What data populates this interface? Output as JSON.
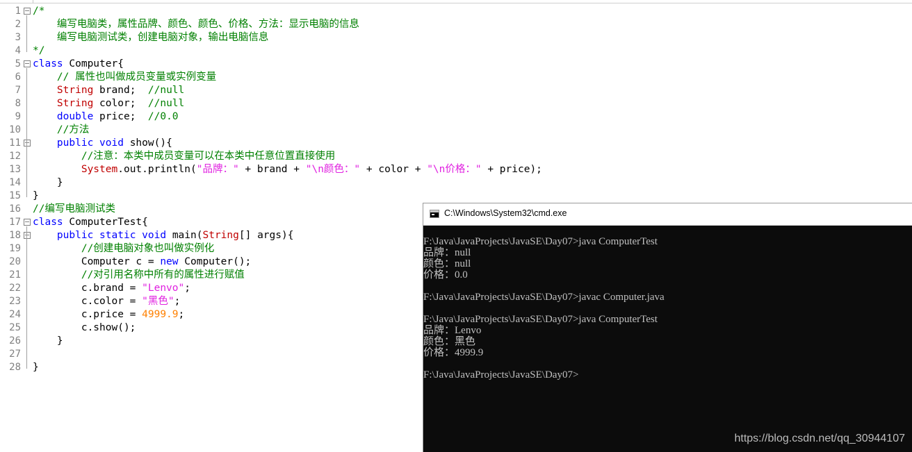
{
  "editor": {
    "lines": [
      {
        "n": "1",
        "fold": true,
        "segs": [
          {
            "t": "/*",
            "c": "cm"
          }
        ]
      },
      {
        "n": "2",
        "segs": [
          {
            "t": "    编写电脑类，属性品牌、颜色、颜色、价格、方法：显示电脑的信息",
            "c": "cm"
          }
        ]
      },
      {
        "n": "3",
        "segs": [
          {
            "t": "    编写电脑测试类，创建电脑对象，输出电脑信息",
            "c": "cm"
          }
        ]
      },
      {
        "n": "4",
        "segs": [
          {
            "t": "*/",
            "c": "cm"
          }
        ]
      },
      {
        "n": "5",
        "fold": true,
        "segs": [
          {
            "t": "class",
            "c": "kw"
          },
          {
            "t": " Computer{",
            "c": ""
          }
        ]
      },
      {
        "n": "6",
        "segs": [
          {
            "t": "    ",
            "c": ""
          },
          {
            "t": "// 属性也叫做成员变量或实例变量",
            "c": "cm"
          }
        ]
      },
      {
        "n": "7",
        "segs": [
          {
            "t": "    ",
            "c": ""
          },
          {
            "t": "String",
            "c": "ty2"
          },
          {
            "t": " brand;  ",
            "c": ""
          },
          {
            "t": "//null",
            "c": "cm"
          }
        ]
      },
      {
        "n": "8",
        "segs": [
          {
            "t": "    ",
            "c": ""
          },
          {
            "t": "String",
            "c": "ty2"
          },
          {
            "t": " color;  ",
            "c": ""
          },
          {
            "t": "//null",
            "c": "cm"
          }
        ]
      },
      {
        "n": "9",
        "segs": [
          {
            "t": "    ",
            "c": ""
          },
          {
            "t": "double",
            "c": "kw"
          },
          {
            "t": " price;  ",
            "c": ""
          },
          {
            "t": "//0.0",
            "c": "cm"
          }
        ]
      },
      {
        "n": "10",
        "segs": [
          {
            "t": "    ",
            "c": ""
          },
          {
            "t": "//方法",
            "c": "cm"
          }
        ]
      },
      {
        "n": "11",
        "fold": true,
        "segs": [
          {
            "t": "    ",
            "c": ""
          },
          {
            "t": "public",
            "c": "kw"
          },
          {
            "t": " ",
            "c": ""
          },
          {
            "t": "void",
            "c": "kw"
          },
          {
            "t": " show(){",
            "c": ""
          }
        ]
      },
      {
        "n": "12",
        "segs": [
          {
            "t": "        ",
            "c": ""
          },
          {
            "t": "//注意：本类中成员变量可以在本类中任意位置直接使用",
            "c": "cm"
          }
        ]
      },
      {
        "n": "13",
        "segs": [
          {
            "t": "        ",
            "c": ""
          },
          {
            "t": "System",
            "c": "ty2"
          },
          {
            "t": ".out.println(",
            "c": ""
          },
          {
            "t": "\"品牌：\"",
            "c": "str"
          },
          {
            "t": " + brand + ",
            "c": ""
          },
          {
            "t": "\"\\n颜色：\"",
            "c": "str"
          },
          {
            "t": " + color + ",
            "c": ""
          },
          {
            "t": "\"\\n价格：\"",
            "c": "str"
          },
          {
            "t": " + price);",
            "c": ""
          }
        ]
      },
      {
        "n": "14",
        "segs": [
          {
            "t": "    }",
            "c": ""
          }
        ]
      },
      {
        "n": "15",
        "segs": [
          {
            "t": "}",
            "c": ""
          }
        ]
      },
      {
        "n": "16",
        "segs": [
          {
            "t": "//编写电脑测试类",
            "c": "cm"
          }
        ]
      },
      {
        "n": "17",
        "fold": true,
        "segs": [
          {
            "t": "class",
            "c": "kw"
          },
          {
            "t": " ComputerTest{",
            "c": ""
          }
        ]
      },
      {
        "n": "18",
        "fold": true,
        "segs": [
          {
            "t": "    ",
            "c": ""
          },
          {
            "t": "public",
            "c": "kw"
          },
          {
            "t": " ",
            "c": ""
          },
          {
            "t": "static",
            "c": "kw"
          },
          {
            "t": " ",
            "c": ""
          },
          {
            "t": "void",
            "c": "kw"
          },
          {
            "t": " main(",
            "c": ""
          },
          {
            "t": "String",
            "c": "ty2"
          },
          {
            "t": "[] args){",
            "c": ""
          }
        ]
      },
      {
        "n": "19",
        "segs": [
          {
            "t": "        ",
            "c": ""
          },
          {
            "t": "//创建电脑对象也叫做实例化",
            "c": "cm"
          }
        ]
      },
      {
        "n": "20",
        "segs": [
          {
            "t": "        Computer c = ",
            "c": ""
          },
          {
            "t": "new",
            "c": "kw"
          },
          {
            "t": " Computer();",
            "c": ""
          }
        ]
      },
      {
        "n": "21",
        "segs": [
          {
            "t": "        ",
            "c": ""
          },
          {
            "t": "//对引用名称中所有的属性进行赋值",
            "c": "cm"
          }
        ]
      },
      {
        "n": "22",
        "segs": [
          {
            "t": "        c.brand = ",
            "c": ""
          },
          {
            "t": "\"Lenvo\"",
            "c": "str"
          },
          {
            "t": ";",
            "c": ""
          }
        ]
      },
      {
        "n": "23",
        "segs": [
          {
            "t": "        c.color = ",
            "c": ""
          },
          {
            "t": "\"黑色\"",
            "c": "str"
          },
          {
            "t": ";",
            "c": ""
          }
        ]
      },
      {
        "n": "24",
        "segs": [
          {
            "t": "        c.price = ",
            "c": ""
          },
          {
            "t": "4999.9",
            "c": "num"
          },
          {
            "t": ";",
            "c": ""
          }
        ]
      },
      {
        "n": "25",
        "segs": [
          {
            "t": "        c.show();",
            "c": ""
          }
        ]
      },
      {
        "n": "26",
        "segs": [
          {
            "t": "    }",
            "c": ""
          }
        ]
      },
      {
        "n": "27",
        "segs": []
      },
      {
        "n": "28",
        "segs": [
          {
            "t": "}",
            "c": ""
          }
        ]
      }
    ]
  },
  "cmd": {
    "title": "C:\\Windows\\System32\\cmd.exe",
    "lines": [
      "F:\\Java\\JavaProjects\\JavaSE\\Day07>java ComputerTest",
      "品牌：null",
      "颜色：null",
      "价格：0.0",
      "",
      "F:\\Java\\JavaProjects\\JavaSE\\Day07>javac Computer.java",
      "",
      "F:\\Java\\JavaProjects\\JavaSE\\Day07>java ComputerTest",
      "品牌：Lenvo",
      "颜色：黑色",
      "价格：4999.9",
      "",
      "F:\\Java\\JavaProjects\\JavaSE\\Day07>"
    ]
  },
  "watermark": "https://blog.csdn.net/qq_30944107",
  "colors": {
    "keyword": "#0000ff",
    "comment": "#008000",
    "string": "#e020e0",
    "number": "#ff8000",
    "type": "#c00000",
    "console_bg": "#0c0c0c",
    "console_fg": "#c0c0c0"
  }
}
